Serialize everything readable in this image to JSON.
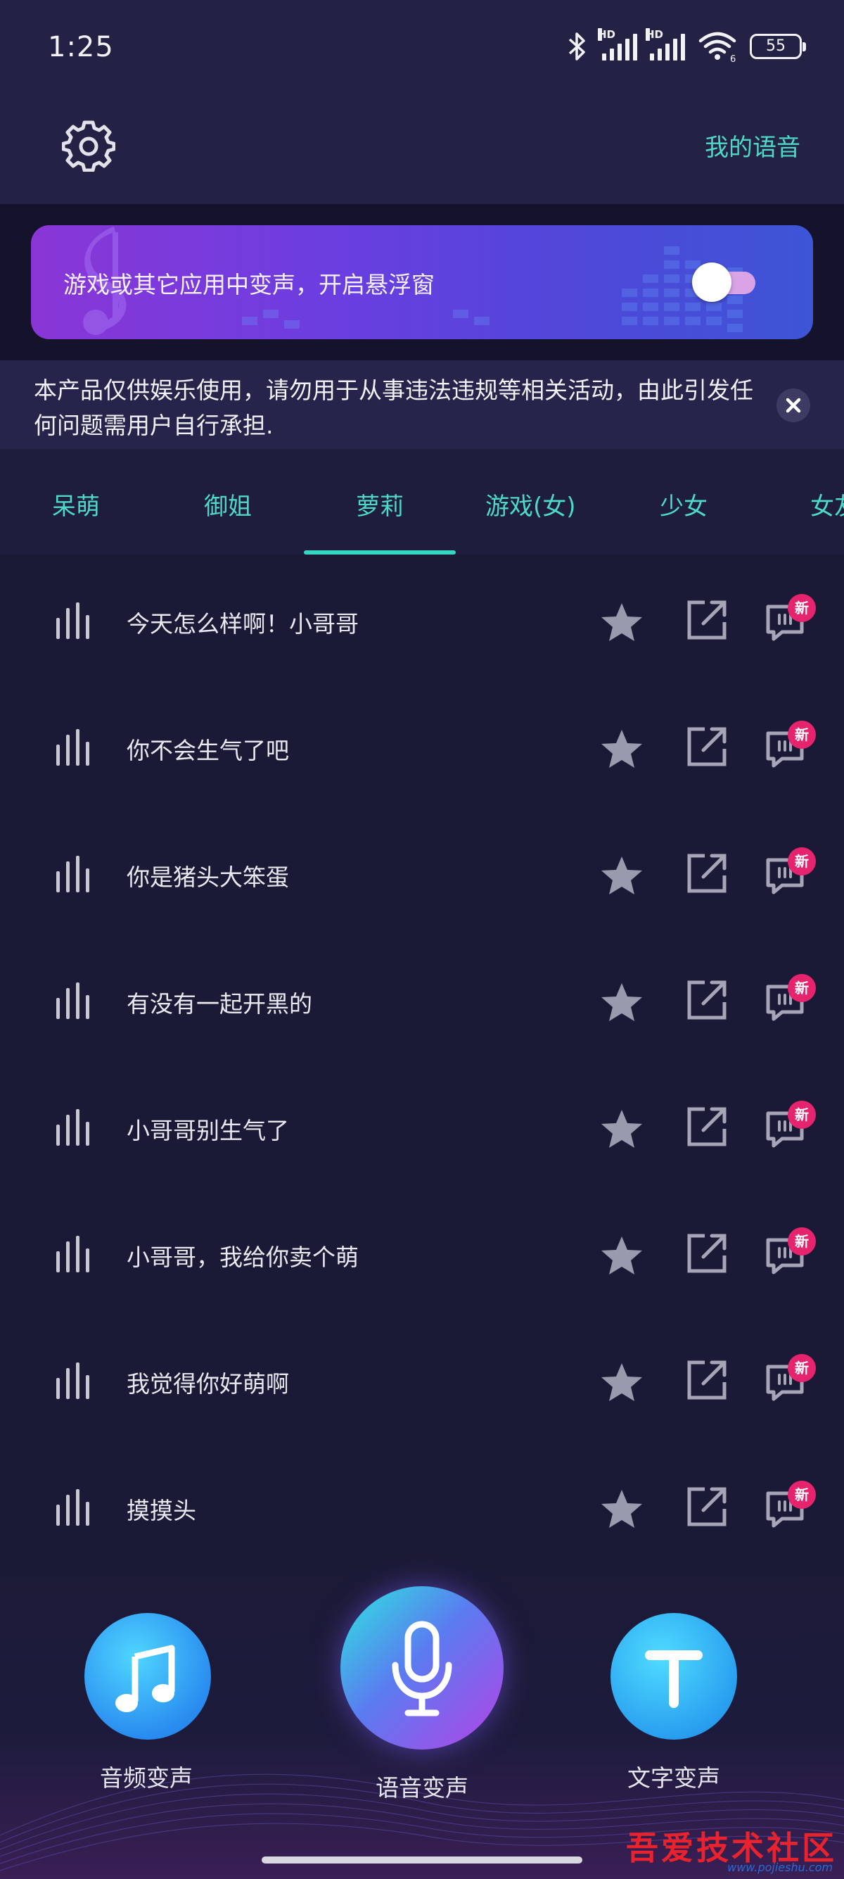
{
  "status_bar": {
    "time": "1:25",
    "battery": "55",
    "signal_1_label": "HD",
    "signal_2_label": "HD",
    "wifi_sub": "6"
  },
  "header": {
    "settings_icon": "gear-icon",
    "my_voice_label": "我的语音"
  },
  "banner": {
    "text": "游戏或其它应用中变声，开启悬浮窗",
    "toggle_on": false
  },
  "notice": {
    "text": "本产品仅供娱乐使用，请勿用于从事违法违规等相关活动，由此引发任何问题需用户自行承担."
  },
  "tabs": {
    "items": [
      "呆萌",
      "御姐",
      "萝莉",
      "游戏(女)",
      "少女",
      "女友"
    ],
    "active_index": 2
  },
  "voices": [
    {
      "title": "今天怎么样啊！小哥哥",
      "badge": "新"
    },
    {
      "title": "你不会生气了吧",
      "badge": "新"
    },
    {
      "title": "你是猪头大笨蛋",
      "badge": "新"
    },
    {
      "title": "有没有一起开黑的",
      "badge": "新"
    },
    {
      "title": "小哥哥别生气了",
      "badge": "新"
    },
    {
      "title": "小哥哥，我给你卖个萌",
      "badge": "新"
    },
    {
      "title": "我觉得你好萌啊",
      "badge": "新"
    },
    {
      "title": "摸摸头",
      "badge": "新"
    }
  ],
  "bottom_nav": {
    "audio_label": "音频变声",
    "voice_label": "语音变声",
    "text_label": "文字变声"
  },
  "watermark": {
    "text": "吾爱技术社区",
    "url": "www.pojieshu.com"
  },
  "colors": {
    "background": "#1b1a36",
    "accent": "#4ed8c6",
    "badge": "#e6246e"
  }
}
